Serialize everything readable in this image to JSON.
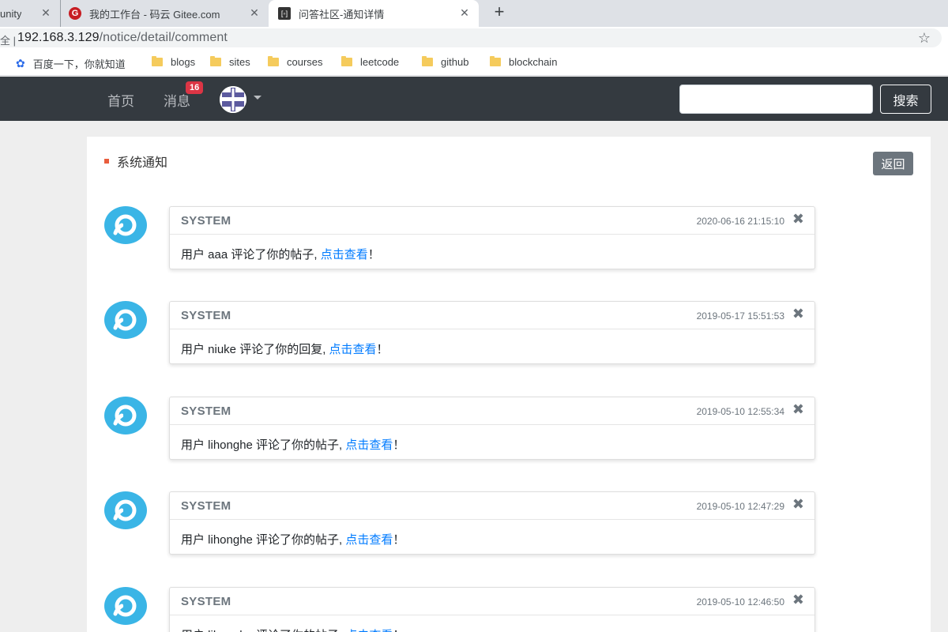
{
  "browser": {
    "tabs": [
      {
        "title": "unity"
      },
      {
        "title": "我的工作台 - 码云 Gitee.com",
        "favicon": "G"
      },
      {
        "title": "问答社区-通知详情",
        "favicon": "[◦]"
      }
    ],
    "tab_close_glyph": "✕",
    "new_tab_glyph": "+",
    "address": {
      "secure_label": "全 |",
      "host": "192.168.3.129",
      "path": "/notice/detail/comment"
    },
    "bookmarks": [
      {
        "label": "百度一下，你就知道",
        "icon": "baidu-paw-icon"
      },
      {
        "label": "blogs",
        "icon": "folder-icon"
      },
      {
        "label": "sites",
        "icon": "folder-icon"
      },
      {
        "label": "courses",
        "icon": "folder-icon"
      },
      {
        "label": "leetcode",
        "icon": "folder-icon"
      },
      {
        "label": "github",
        "icon": "folder-icon"
      },
      {
        "label": "blockchain",
        "icon": "folder-icon"
      }
    ]
  },
  "navbar": {
    "home": "首页",
    "messages": "消息",
    "message_badge": "16",
    "search_placeholder": "",
    "search_button": "搜索"
  },
  "page": {
    "section_title": "系统通知",
    "back_button": "返回"
  },
  "notices": [
    {
      "sender": "SYSTEM",
      "time": "2020-06-16 21:15:10",
      "prefix": "用户 aaa 评论了你的帖子, ",
      "link": "点击查看",
      "suffix": "！"
    },
    {
      "sender": "SYSTEM",
      "time": "2019-05-17 15:51:53",
      "prefix": "用户 niuke 评论了你的回复, ",
      "link": "点击查看",
      "suffix": "！"
    },
    {
      "sender": "SYSTEM",
      "time": "2019-05-10 12:55:34",
      "prefix": "用户 lihonghe 评论了你的帖子, ",
      "link": "点击查看",
      "suffix": "！"
    },
    {
      "sender": "SYSTEM",
      "time": "2019-05-10 12:47:29",
      "prefix": "用户 lihonghe 评论了你的帖子, ",
      "link": "点击查看",
      "suffix": "！"
    },
    {
      "sender": "SYSTEM",
      "time": "2019-05-10 12:46:50",
      "prefix": "用户 lihonghe 评论了你的帖子, ",
      "link": "点击查看",
      "suffix": "！"
    }
  ],
  "colors": {
    "navbar_bg": "#343a40",
    "badge_red": "#dc3545",
    "link_blue": "#007bff",
    "avatar_blue": "#3ab5e6",
    "section_mark": "#e95d3d"
  }
}
